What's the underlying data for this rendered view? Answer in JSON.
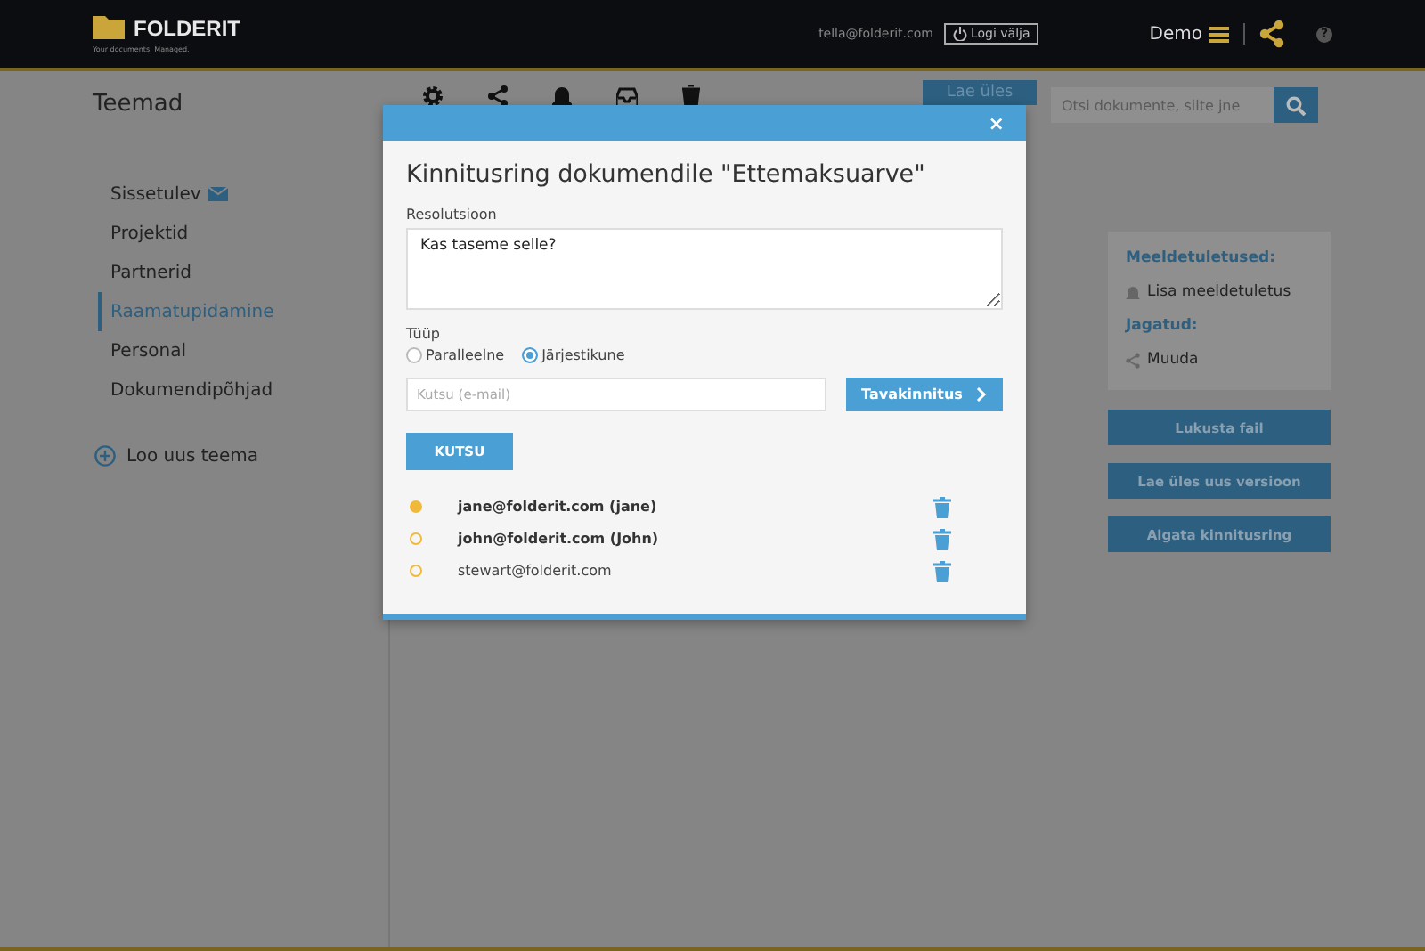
{
  "header": {
    "brand": "FOLDERIT",
    "tagline": "Your documents. Managed.",
    "email": "tella@folderit.com",
    "logout": "Logi välja",
    "account": "Demo",
    "help": "?"
  },
  "toolbar": {
    "title": "Teemad",
    "upload": "Lae üles",
    "search": {
      "placeholder": "Otsi dokumente, silte jne"
    }
  },
  "sidebar": {
    "items": [
      {
        "label": "Sissetulev",
        "selected": false,
        "unread": true
      },
      {
        "label": "Projektid",
        "selected": false,
        "unread": false
      },
      {
        "label": "Partnerid",
        "selected": false,
        "unread": false
      },
      {
        "label": "Raamatupidamine",
        "selected": true,
        "unread": false
      },
      {
        "label": "Personal",
        "selected": false,
        "unread": false
      },
      {
        "label": "Dokumendipõhjad",
        "selected": false,
        "unread": false
      }
    ],
    "add": "Loo uus teema"
  },
  "details": {
    "reminders_heading": "Meeldetuletused:",
    "add_reminder": "Lisa meeldetuletus",
    "shared_heading": "Jagatud:",
    "share_edit": "Muuda",
    "buttons": [
      "Lukusta fail",
      "Lae üles uus versioon",
      "Algata kinnitusring"
    ]
  },
  "dialog": {
    "close": "×",
    "title": "Kinnitusring dokumendile \"Ettemaksuarve\"",
    "resolution_label": "Resolutsioon",
    "resolution": "Kas taseme selle?",
    "type_label": "Tüüp",
    "types": [
      {
        "label": "Paralleelne",
        "selected": false
      },
      {
        "label": "Järjestikune",
        "selected": true
      }
    ],
    "invite": {
      "placeholder": "Kutsu (e-mail)"
    },
    "approval_button": "Tavakinnitus",
    "invite_button": "KUTSU",
    "participants": [
      {
        "name": "jane@folderit.com (jane)",
        "confirmed": true,
        "registered": true
      },
      {
        "name": "john@folderit.com (John)",
        "confirmed": false,
        "registered": true
      },
      {
        "name": "stewart@folderit.com",
        "confirmed": false,
        "registered": false
      }
    ]
  }
}
